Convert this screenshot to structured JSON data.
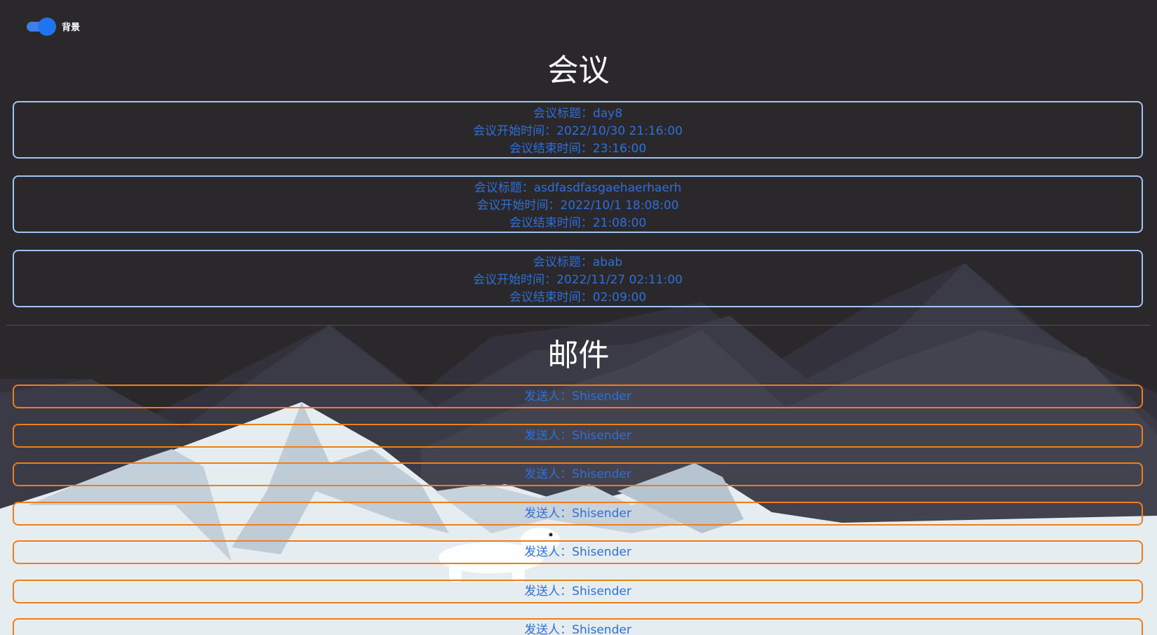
{
  "toggle": {
    "label": "背景",
    "state": "on",
    "accent_color": "#1f74f0"
  },
  "meetings": {
    "heading": "会议",
    "items": [
      {
        "title_line": "会议标题：day8",
        "start_line": "会议开始时间：2022/10/30 21:16:00",
        "end_line": "会议结束时间：23:16:00"
      },
      {
        "title_line": "会议标题：asdfasdfasgaehaerhaerh",
        "start_line": "会议开始时间：2022/10/1 18:08:00",
        "end_line": "会议结束时间：21:08:00"
      },
      {
        "title_line": "会议标题：abab",
        "start_line": "会议开始时间：2022/11/27 02:11:00",
        "end_line": "会议结束时间：02:09:00"
      }
    ],
    "border_color": "#a3c4f3"
  },
  "mails": {
    "heading": "邮件",
    "items": [
      {
        "sender_line": "发送人：Shisender"
      },
      {
        "sender_line": "发送人：Shisender"
      },
      {
        "sender_line": "发送人：Shisender"
      },
      {
        "sender_line": "发送人：Shisender"
      },
      {
        "sender_line": "发送人：Shisender"
      },
      {
        "sender_line": "发送人：Shisender"
      },
      {
        "sender_line": "发送人：Shisender"
      }
    ],
    "border_color": "#ef7d1c"
  },
  "colors": {
    "text_blue": "#2f6fd8",
    "background_dark": "#2a282b"
  }
}
